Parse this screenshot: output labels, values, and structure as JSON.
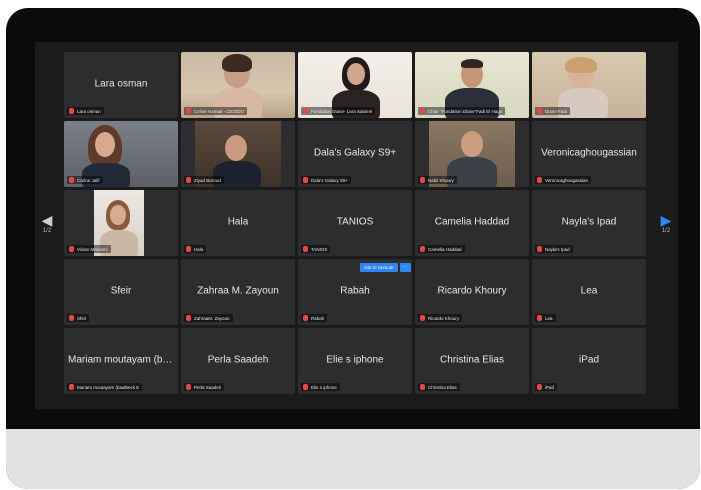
{
  "navigation": {
    "left_page": "1/2",
    "right_page": "1/2"
  },
  "participants": [
    {
      "display": "Lara osman",
      "caption": "Lara osman",
      "video": false
    },
    {
      "display": "",
      "caption": "Celine Hamati - CEO/DO",
      "video": true
    },
    {
      "display": "",
      "caption": "Fondation Diane- Lara Salamé",
      "video": true
    },
    {
      "display": "",
      "caption": "Chair \"Fondation Diane\"Fadi El Hage",
      "video": true,
      "active": true
    },
    {
      "display": "",
      "caption": "Diane Fadi",
      "video": true
    },
    {
      "display": "",
      "caption": "Carine Jalif",
      "video": true
    },
    {
      "display": "",
      "caption": "Ziyad Baroud",
      "video": true
    },
    {
      "display": "Dala's Galaxy S9+",
      "caption": "Dala's Galaxy S9+",
      "video": false
    },
    {
      "display": "",
      "caption": "Nabil Khoury",
      "video": true
    },
    {
      "display": "Veronicaghougassian",
      "caption": "Veronicaghougassian",
      "video": false
    },
    {
      "display": "",
      "caption": "Vivian Mahanni",
      "video": true
    },
    {
      "display": "Hala",
      "caption": "Hala",
      "video": false
    },
    {
      "display": "TANIOS",
      "caption": "TANIOS",
      "video": false
    },
    {
      "display": "Camelia Haddad",
      "caption": "Camelia Haddad",
      "video": false
    },
    {
      "display": "Nayla's Ipad",
      "caption": "Nayla's Ipad",
      "video": false
    },
    {
      "display": "Sfeir",
      "caption": "Sfeir",
      "video": false
    },
    {
      "display": "Zahraa M. Zayoun",
      "caption": "ZahraaM. Zayoun",
      "video": false
    },
    {
      "display": "Rabah",
      "caption": "Rabah",
      "video": false,
      "hover_menu": {
        "button": "Ask to Unmute",
        "more": "···"
      }
    },
    {
      "display": "Ricardo Khoury",
      "caption": "Ricardo Khoury",
      "video": false
    },
    {
      "display": "Lea",
      "caption": "Lea",
      "video": false
    },
    {
      "display": "Mariam moutayam (baal...",
      "caption": "Mariam moutayam (baalbeck E",
      "video": false
    },
    {
      "display": "Perla Saadeh",
      "caption": "Perla Saadeh",
      "video": false
    },
    {
      "display": "Elie s iphone",
      "caption": "Elie s iphone",
      "video": false
    },
    {
      "display": "Christina Elias",
      "caption": "Christina Elias",
      "video": false
    },
    {
      "display": "iPad",
      "caption": "iPad",
      "video": false
    }
  ],
  "icons": {
    "mic": "mic-muted-icon",
    "prev": "chevron-left-icon",
    "next": "chevron-right-icon"
  },
  "colors": {
    "accent": "#2f86f6",
    "active_border": "#c9e04a",
    "muted_mic": "#e2484a",
    "tile_bg": "#2d2d2f"
  }
}
